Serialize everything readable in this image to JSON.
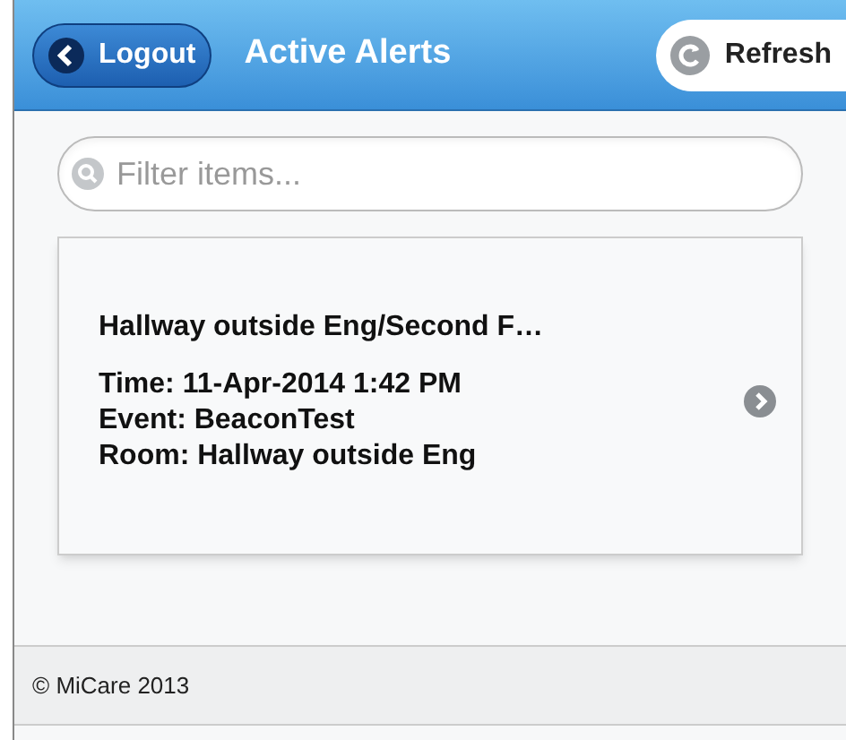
{
  "header": {
    "title": "Active Alerts",
    "left_button": "Logout",
    "right_button": "Refresh"
  },
  "filter": {
    "placeholder": "Filter items..."
  },
  "alerts": [
    {
      "title": "Hallway outside Eng/Second F…",
      "lines": [
        "Time: 11-Apr-2014 1:42 PM",
        "Event: BeaconTest",
        "Room: Hallway outside Eng"
      ]
    }
  ],
  "footer": "© MiCare 2013"
}
